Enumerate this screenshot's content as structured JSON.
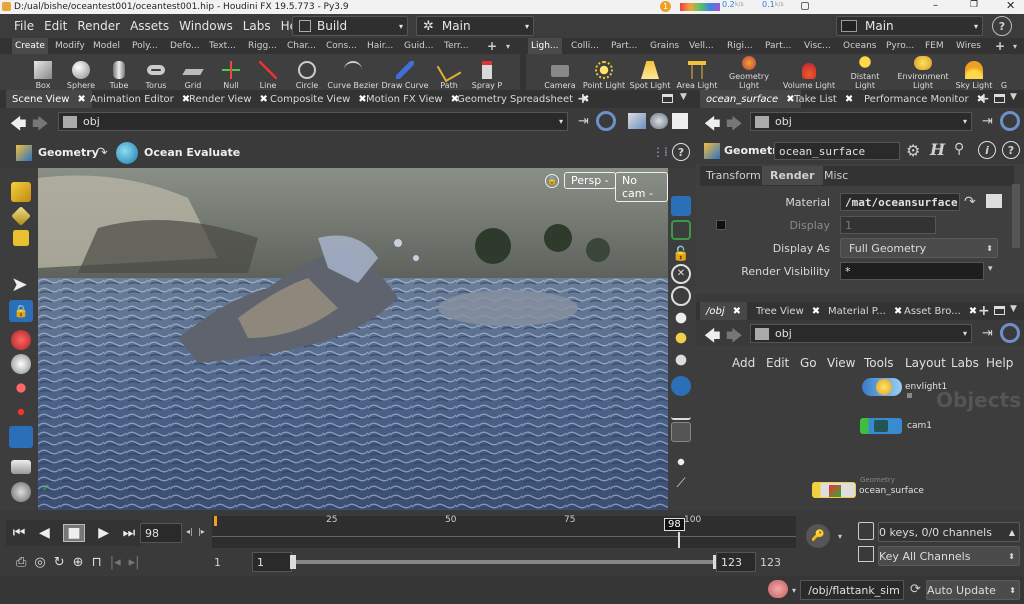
{
  "window": {
    "title": "D:/ual/bishe/oceantest001/oceantest001.hip - Houdini FX 19.5.773 - Py3.9",
    "tray_badge": "1",
    "net_up": "0.2",
    "net_down": "0.1",
    "net_unit": "k/s"
  },
  "menubar": {
    "items": [
      "File",
      "Edit",
      "Render",
      "Assets",
      "Windows",
      "Labs",
      "Help"
    ],
    "desktop": "Build",
    "context": "Main",
    "right_desktop": "Main"
  },
  "shelf": {
    "left_tabs": [
      "Create",
      "Modify",
      "Model",
      "Poly...",
      "Defo...",
      "Text...",
      "Rigg...",
      "Char...",
      "Cons...",
      "Hair...",
      "Guid...",
      "Terr..."
    ],
    "right_tabs": [
      "Ligh...",
      "Colli...",
      "Part...",
      "Grains",
      "Vell...",
      "Rigi...",
      "Part...",
      "Visc...",
      "Oceans",
      "Pyro...",
      "FEM",
      "Wires"
    ],
    "left_tools": [
      "Box",
      "Sphere",
      "Tube",
      "Torus",
      "Grid",
      "Null",
      "Line",
      "Circle",
      "Curve Bezier",
      "Draw Curve",
      "Path",
      "Spray P"
    ],
    "right_tools": [
      "Camera",
      "Point Light",
      "Spot Light",
      "Area Light",
      "Geometry Light",
      "Volume Light",
      "Distant Light",
      "Environment Light",
      "Sky Light",
      "G"
    ]
  },
  "left_pane": {
    "tabs": [
      "Scene View",
      "Animation Editor",
      "Render View",
      "Composite View",
      "Motion FX View",
      "Geometry Spreadsheet"
    ],
    "path": "obj",
    "context_label": "Geometry",
    "state_label": "Ocean Evaluate",
    "camera_menu": "Persp -",
    "cam_menu": "No cam -"
  },
  "param_pane": {
    "tabs": [
      "ocean_surface",
      "Take List",
      "Performance Monitor"
    ],
    "path": "obj",
    "node_type": "Geometry",
    "node_name": "ocean_surface",
    "subtabs": [
      "Transform",
      "Render",
      "Misc"
    ],
    "params": {
      "material_label": "Material",
      "material_value": "/mat/oceansurface",
      "display_label": "Display",
      "display_value": "1",
      "display_as_label": "Display As",
      "display_as_value": "Full Geometry",
      "render_vis_label": "Render Visibility",
      "render_vis_value": "*"
    }
  },
  "network_pane": {
    "tabs": [
      "/obj",
      "Tree View",
      "Material P...",
      "Asset Bro..."
    ],
    "path": "obj",
    "menus": [
      "Add",
      "Edit",
      "Go",
      "View",
      "Tools",
      "Layout",
      "Labs",
      "Help"
    ],
    "watermark": "Objects",
    "nodes": [
      {
        "name": "envlight1"
      },
      {
        "name": "cam1"
      },
      {
        "name": "ocean_surface",
        "type_label": "Geometry"
      }
    ]
  },
  "timeline": {
    "current_frame": "98",
    "ruler_ticks": [
      "25",
      "50",
      "75",
      "100"
    ],
    "marker": "98",
    "start": "1",
    "start2": "1",
    "end": "123",
    "end2": "123",
    "keys": "0 keys, 0/0 channels",
    "key_all": "Key All Channels",
    "status_path": "/obj/flattank_sim",
    "update_mode": "Auto Update"
  },
  "colors": {
    "accent": "#f0a020",
    "selected_blue": "#2a6fb8"
  }
}
